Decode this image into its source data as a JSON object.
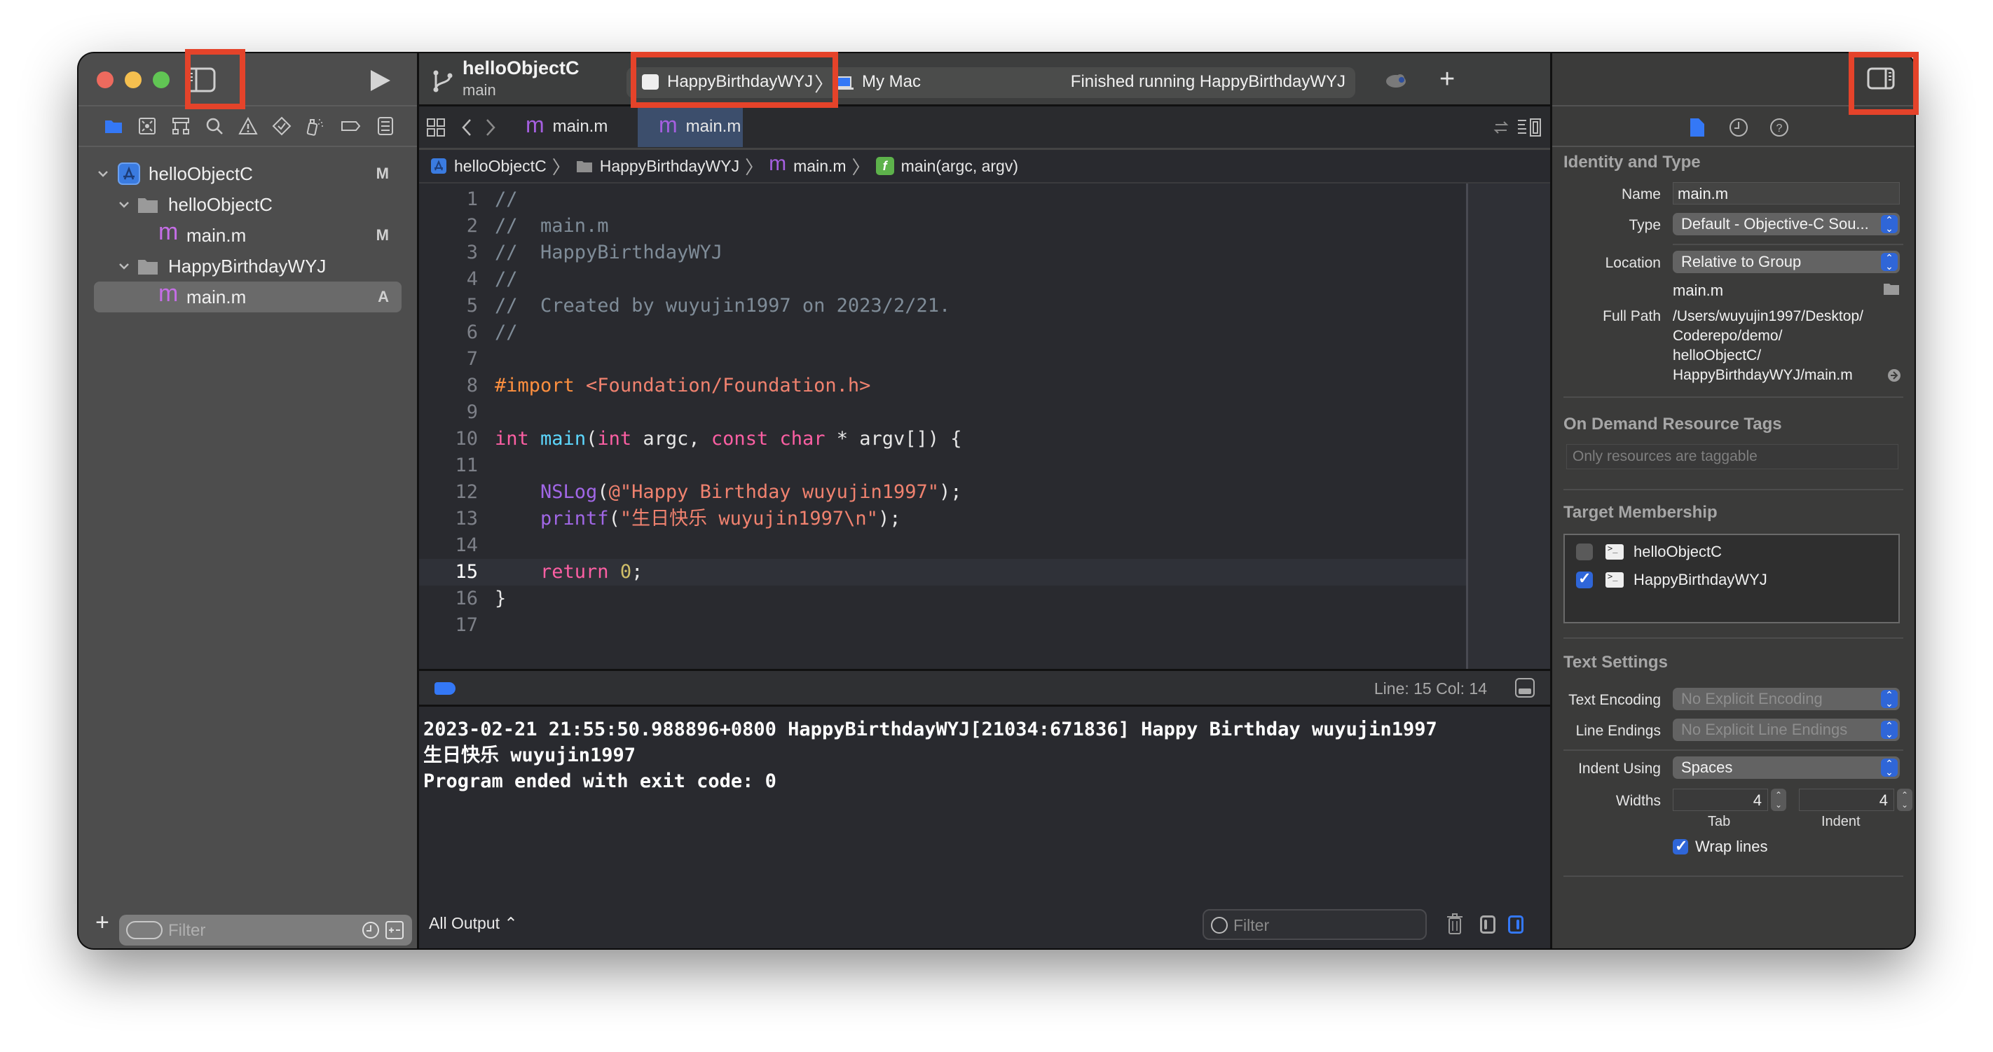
{
  "window": {
    "traffic_lights": [
      "close",
      "minimize",
      "zoom"
    ]
  },
  "toolbar": {
    "project_title": "helloObjectC",
    "branch": "main",
    "scheme": "HappyBirthdayWYJ",
    "destination": "My Mac",
    "status": "Finished running HappyBirthdayWYJ",
    "add_label": "+"
  },
  "navigator": {
    "icons": [
      "folder-icon",
      "source-control-icon",
      "symbol-hierarchy-icon",
      "find-icon",
      "issue-warning-icon",
      "test-diamond-icon",
      "debug-spray-icon",
      "breakpoint-tag-icon",
      "report-list-icon"
    ],
    "tree": [
      {
        "label": "helloObjectC",
        "type": "project",
        "level": 0,
        "expanded": true,
        "badge": "M"
      },
      {
        "label": "helloObjectC",
        "type": "folder",
        "level": 1,
        "expanded": true,
        "badge": ""
      },
      {
        "label": "main.m",
        "type": "file",
        "level": 2,
        "badge": "M"
      },
      {
        "label": "HappyBirthdayWYJ",
        "type": "folder",
        "level": 1,
        "expanded": true,
        "badge": ""
      },
      {
        "label": "main.m",
        "type": "file",
        "level": 2,
        "badge": "A",
        "selected": true
      }
    ],
    "filter_placeholder": "Filter"
  },
  "editor": {
    "tabs": [
      {
        "label": "main.m",
        "active": false
      },
      {
        "label": "main.m",
        "active": true
      }
    ],
    "breadcrumb": [
      "helloObjectC",
      "HappyBirthdayWYJ",
      "main.m",
      "main(argc, argv)"
    ],
    "current_line": 15,
    "lines": [
      {
        "n": "1",
        "tokens": [
          {
            "c": "comment",
            "t": "//"
          }
        ]
      },
      {
        "n": "2",
        "tokens": [
          {
            "c": "comment",
            "t": "//  main.m"
          }
        ]
      },
      {
        "n": "3",
        "tokens": [
          {
            "c": "comment",
            "t": "//  HappyBirthdayWYJ"
          }
        ]
      },
      {
        "n": "4",
        "tokens": [
          {
            "c": "comment",
            "t": "//"
          }
        ]
      },
      {
        "n": "5",
        "tokens": [
          {
            "c": "comment",
            "t": "//  Created by wuyujin1997 on 2023/2/21."
          }
        ]
      },
      {
        "n": "6",
        "tokens": [
          {
            "c": "comment",
            "t": "//"
          }
        ]
      },
      {
        "n": "7",
        "tokens": []
      },
      {
        "n": "8",
        "tokens": [
          {
            "c": "pre",
            "t": "#import "
          },
          {
            "c": "str",
            "t": "<Foundation/Foundation.h>"
          }
        ]
      },
      {
        "n": "9",
        "tokens": []
      },
      {
        "n": "10",
        "tokens": [
          {
            "c": "kw",
            "t": "int"
          },
          {
            "c": "plain",
            "t": " "
          },
          {
            "c": "fn",
            "t": "main"
          },
          {
            "c": "plain",
            "t": "("
          },
          {
            "c": "kw",
            "t": "int"
          },
          {
            "c": "plain",
            "t": " argc, "
          },
          {
            "c": "kw",
            "t": "const"
          },
          {
            "c": "plain",
            "t": " "
          },
          {
            "c": "kw",
            "t": "char"
          },
          {
            "c": "plain",
            "t": " * argv[]) {"
          }
        ]
      },
      {
        "n": "11",
        "tokens": []
      },
      {
        "n": "12",
        "tokens": [
          {
            "c": "plain",
            "t": "    "
          },
          {
            "c": "call",
            "t": "NSLog"
          },
          {
            "c": "plain",
            "t": "("
          },
          {
            "c": "str",
            "t": "@\"Happy Birthday wuyujin1997\""
          },
          {
            "c": "plain",
            "t": ");"
          }
        ]
      },
      {
        "n": "13",
        "tokens": [
          {
            "c": "plain",
            "t": "    "
          },
          {
            "c": "call",
            "t": "printf"
          },
          {
            "c": "plain",
            "t": "("
          },
          {
            "c": "str",
            "t": "\"生日快乐 wuyujin1997\\n\""
          },
          {
            "c": "plain",
            "t": ");"
          }
        ]
      },
      {
        "n": "14",
        "tokens": []
      },
      {
        "n": "15",
        "tokens": [
          {
            "c": "plain",
            "t": "    "
          },
          {
            "c": "kw",
            "t": "return"
          },
          {
            "c": "plain",
            "t": " "
          },
          {
            "c": "num",
            "t": "0"
          },
          {
            "c": "plain",
            "t": ";"
          }
        ]
      },
      {
        "n": "16",
        "tokens": [
          {
            "c": "plain",
            "t": "}"
          }
        ]
      },
      {
        "n": "17",
        "tokens": []
      }
    ],
    "cursor": "Line: 15  Col: 14"
  },
  "console": {
    "lines": [
      "2023-02-21 21:55:50.988896+0800 HappyBirthdayWYJ[21034:671836] Happy Birthday wuyujin1997",
      "生日快乐 wuyujin1997",
      "Program ended with exit code: 0"
    ],
    "output_selector": "All Output ⌃",
    "filter_placeholder": "Filter"
  },
  "inspector": {
    "tabs": [
      "file-inspector-icon",
      "history-icon",
      "quick-help-icon"
    ],
    "identity": {
      "title": "Identity and Type",
      "name_label": "Name",
      "name_value": "main.m",
      "type_label": "Type",
      "type_value": "Default - Objective-C Sou...",
      "location_label": "Location",
      "location_value": "Relative to Group",
      "location_file": "main.m",
      "fullpath_label": "Full Path",
      "fullpath_lines": [
        "/Users/wuyujin1997/Desktop/",
        "Coderepo/demo/",
        "helloObjectC/",
        "HappyBirthdayWYJ/main.m"
      ]
    },
    "odr": {
      "title": "On Demand Resource Tags",
      "placeholder": "Only resources are taggable"
    },
    "membership": {
      "title": "Target Membership",
      "targets": [
        {
          "name": "helloObjectC",
          "checked": false
        },
        {
          "name": "HappyBirthdayWYJ",
          "checked": true
        }
      ]
    },
    "text_settings": {
      "title": "Text Settings",
      "encoding_label": "Text Encoding",
      "encoding_value": "No Explicit Encoding",
      "endings_label": "Line Endings",
      "endings_value": "No Explicit Line Endings",
      "indent_label": "Indent Using",
      "indent_value": "Spaces",
      "widths_label": "Widths",
      "tab_width": "4",
      "tab_label": "Tab",
      "indent_width": "4",
      "indent_sub_label": "Indent",
      "wrap_label": "Wrap lines",
      "wrap_checked": true
    }
  },
  "colors": {
    "accent": "#3478f6",
    "highlight_annotation": "#e5432a"
  }
}
